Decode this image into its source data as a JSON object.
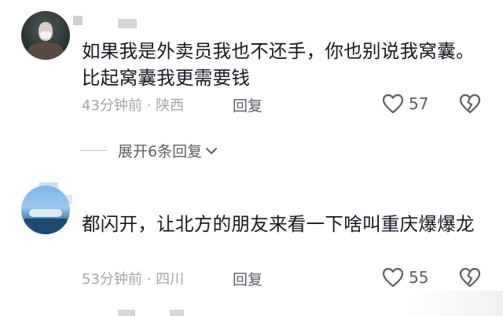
{
  "comments": [
    {
      "text": "如果我是外卖员我也不还手，你也别说我窝囊。比起窝囊我更需要钱",
      "time_location": "43分钟前 · 陕西",
      "reply_label": "回复",
      "likes": "57"
    },
    {
      "text": "都闪开，让北方的朋友来看一下啥叫重庆爆爆龙",
      "time_location": "53分钟前 · 四川",
      "reply_label": "回复",
      "likes": "55"
    }
  ],
  "expand_replies": {
    "label": "展开6条回复"
  },
  "icons": {
    "like": "heart-outline-icon",
    "dislike": "broken-heart-icon",
    "expand": "chevron-down-icon"
  },
  "colors": {
    "text": "#161823",
    "meta": "#a3a5ad",
    "action": "#5c5e66"
  }
}
